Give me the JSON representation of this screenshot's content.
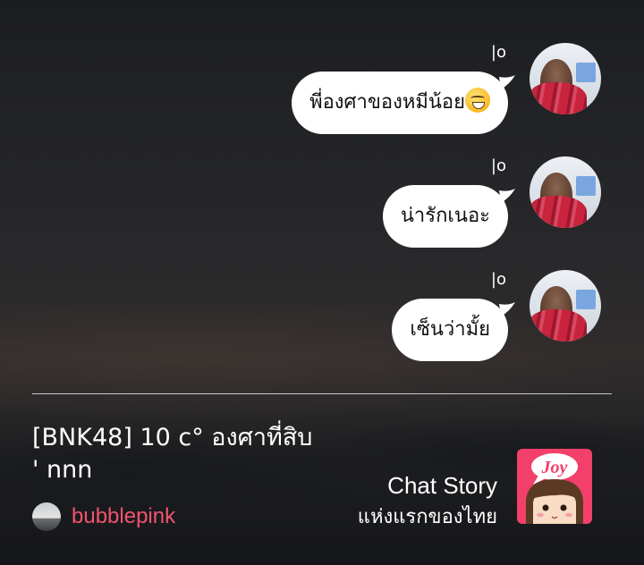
{
  "messages": [
    {
      "sender": "|o",
      "text": "พี่องศาของหมีน้อย",
      "emoji": "grinning-face-emoji"
    },
    {
      "sender": "|o",
      "text": "น่ารักเนอะ"
    },
    {
      "sender": "|o",
      "text": "เซ็นว่ามั้ย"
    }
  ],
  "story": {
    "title": "[BNK48] 10 c° องศาที่สิบ ' nnn",
    "author": "bubblepink"
  },
  "brand": {
    "line1": "Chat Story",
    "line2": "แห่งแรกของไทย",
    "logo_text": "Joy"
  },
  "colors": {
    "bubble": "#ffffff",
    "author_name": "#f2536f",
    "app_icon": "#f2406a"
  }
}
